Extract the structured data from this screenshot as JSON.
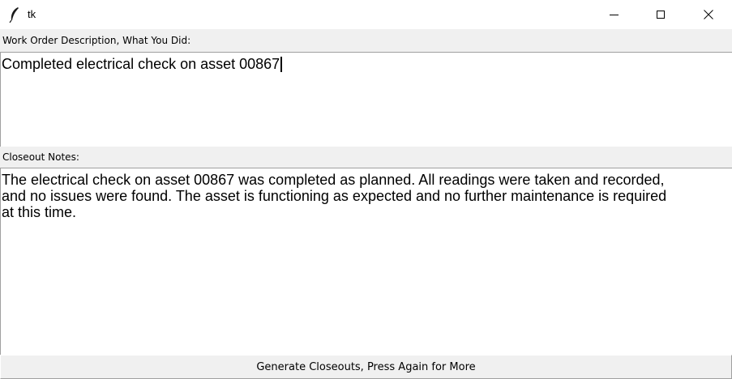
{
  "window": {
    "title": "tk",
    "icon": "feather-icon",
    "controls": {
      "minimize_icon": "minimize-icon",
      "maximize_icon": "maximize-icon",
      "close_icon": "close-icon"
    }
  },
  "description": {
    "label": "Work Order Description, What You Did:",
    "value": "Completed electrical check on asset 00867"
  },
  "notes": {
    "label": "Closeout Notes:",
    "value": "The electrical check on asset 00867 was completed as planned. All readings were taken and recorded,\nand no issues were found. The asset is functioning as expected and no further maintenance is required\nat this time."
  },
  "action": {
    "label": "Generate Closeouts, Press Again for More"
  }
}
